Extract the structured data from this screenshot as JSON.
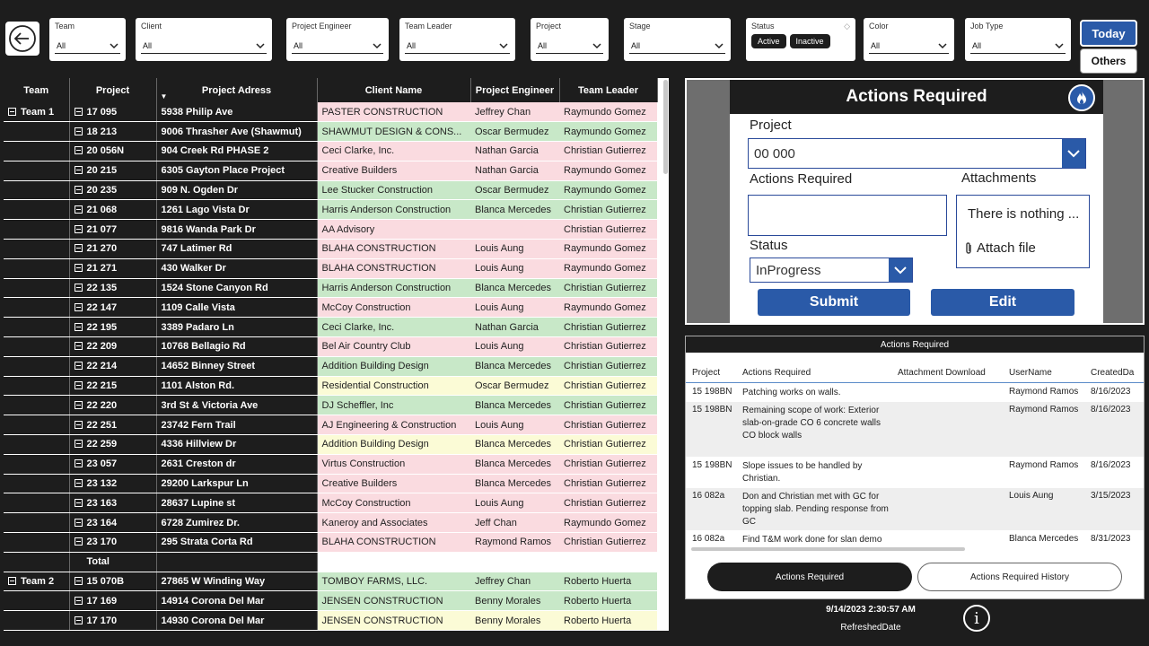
{
  "filters": [
    {
      "label": "Team",
      "value": "All"
    },
    {
      "label": "Client",
      "value": "All"
    },
    {
      "label": "Project Engineer",
      "value": "All"
    },
    {
      "label": "Team Leader",
      "value": "All"
    },
    {
      "label": "Project",
      "value": "All"
    },
    {
      "label": "Stage",
      "value": "All"
    },
    {
      "label": "Color",
      "value": "All"
    },
    {
      "label": "Job Type",
      "value": "All"
    }
  ],
  "status_filter": {
    "label": "Status",
    "options": [
      "Active",
      "Inactive"
    ]
  },
  "buttons": {
    "today": "Today",
    "others": "Others"
  },
  "table": {
    "headers": [
      "Team",
      "Project",
      "Project Adress",
      "Client Name",
      "Project Engineer",
      "Team Leader"
    ],
    "rows": [
      {
        "team": "Team 1",
        "project": "17 095",
        "address": "5938 Philip Ave",
        "client": "PASTER CONSTRUCTION",
        "engineer": "Jeffrey Chan",
        "leader": "Raymundo Gomez",
        "color": "pink"
      },
      {
        "team": "",
        "project": "18 213",
        "address": "9006 Thrasher Ave (Shawmut)",
        "client": "SHAWMUT DESIGN & CONS...",
        "engineer": "Oscar Bermudez",
        "leader": "Raymundo Gomez",
        "color": "green"
      },
      {
        "team": "",
        "project": "20 056N",
        "address": "904 Creek Rd PHASE 2",
        "client": "Ceci Clarke, Inc.",
        "engineer": "Nathan Garcia",
        "leader": "Christian Gutierrez",
        "color": "pink"
      },
      {
        "team": "",
        "project": "20 215",
        "address": "6305 Gayton Place Project",
        "client": "Creative Builders",
        "engineer": "Nathan Garcia",
        "leader": "Raymundo Gomez",
        "color": "pink"
      },
      {
        "team": "",
        "project": "20 235",
        "address": "909 N. Ogden Dr",
        "client": "Lee Stucker Construction",
        "engineer": "Oscar Bermudez",
        "leader": "Raymundo Gomez",
        "color": "green"
      },
      {
        "team": "",
        "project": "21 068",
        "address": "1261 Lago Vista Dr",
        "client": "Harris Anderson Construction",
        "engineer": "Blanca Mercedes",
        "leader": "Christian Gutierrez",
        "color": "green"
      },
      {
        "team": "",
        "project": "21 077",
        "address": "9816 Wanda Park Dr",
        "client": "AA Advisory",
        "engineer": "",
        "leader": "Christian Gutierrez",
        "color": "pink"
      },
      {
        "team": "",
        "project": "21 270",
        "address": "747 Latimer Rd",
        "client": "BLAHA CONSTRUCTION",
        "engineer": "Louis Aung",
        "leader": "Raymundo Gomez",
        "color": "pink"
      },
      {
        "team": "",
        "project": "21 271",
        "address": "430 Walker Dr",
        "client": "BLAHA CONSTRUCTION",
        "engineer": "Louis Aung",
        "leader": "Raymundo Gomez",
        "color": "pink"
      },
      {
        "team": "",
        "project": "22 135",
        "address": "1524 Stone Canyon Rd",
        "client": "Harris Anderson Construction",
        "engineer": "Blanca Mercedes",
        "leader": "Christian Gutierrez",
        "color": "green"
      },
      {
        "team": "",
        "project": "22 147",
        "address": "1109 Calle Vista",
        "client": "McCoy Construction",
        "engineer": "Louis Aung",
        "leader": "Raymundo Gomez",
        "color": "pink"
      },
      {
        "team": "",
        "project": "22 195",
        "address": "3389 Padaro Ln",
        "client": "Ceci Clarke, Inc.",
        "engineer": "Nathan Garcia",
        "leader": "Christian Gutierrez",
        "color": "green"
      },
      {
        "team": "",
        "project": "22 209",
        "address": "10768 Bellagio Rd",
        "client": "Bel Air Country Club",
        "engineer": "Louis Aung",
        "leader": "Christian Gutierrez",
        "color": "pink"
      },
      {
        "team": "",
        "project": "22 214",
        "address": "14652 Binney Street",
        "client": "Addition Building Design",
        "engineer": "Blanca Mercedes",
        "leader": "Christian Gutierrez",
        "color": "green"
      },
      {
        "team": "",
        "project": "22 215",
        "address": "1101 Alston Rd.",
        "client": "Residential Construction",
        "engineer": "Oscar Bermudez",
        "leader": "Christian Gutierrez",
        "color": "yellow"
      },
      {
        "team": "",
        "project": "22 220",
        "address": "3rd St & Victoria Ave",
        "client": "DJ Scheffler, Inc",
        "engineer": "Blanca Mercedes",
        "leader": "Christian Gutierrez",
        "color": "green"
      },
      {
        "team": "",
        "project": "22 251",
        "address": "23742 Fern Trail",
        "client": "AJ Engineering & Construction",
        "engineer": "Louis Aung",
        "leader": "Christian Gutierrez",
        "color": "pink"
      },
      {
        "team": "",
        "project": "22 259",
        "address": "4336 Hillview Dr",
        "client": "Addition Building Design",
        "engineer": "Blanca Mercedes",
        "leader": "Christian Gutierrez",
        "color": "yellow"
      },
      {
        "team": "",
        "project": "23 057",
        "address": "2631 Creston dr",
        "client": "Virtus Construction",
        "engineer": "Blanca Mercedes",
        "leader": "Christian Gutierrez",
        "color": "pink"
      },
      {
        "team": "",
        "project": "23 132",
        "address": "29200 Larkspur Ln",
        "client": "Creative Builders",
        "engineer": "Blanca Mercedes",
        "leader": "Christian Gutierrez",
        "color": "pink"
      },
      {
        "team": "",
        "project": "23 163",
        "address": "28637 Lupine st",
        "client": "McCoy Construction",
        "engineer": "Louis Aung",
        "leader": "Christian Gutierrez",
        "color": "pink"
      },
      {
        "team": "",
        "project": "23 164",
        "address": "6728 Zumirez Dr.",
        "client": "Kaneroy and Associates",
        "engineer": "Jeff Chan",
        "leader": "Raymundo Gomez",
        "color": "pink"
      },
      {
        "team": "",
        "project": "23 170",
        "address": "295 Strata Corta Rd",
        "client": "BLAHA CONSTRUCTION",
        "engineer": "Raymond Ramos",
        "leader": "Christian Gutierrez",
        "color": "pink"
      },
      {
        "team": "",
        "project": "Total",
        "address": "",
        "client": "",
        "engineer": "",
        "leader": "",
        "color": "total",
        "is_total": true
      },
      {
        "team": "Team 2",
        "project": "15 070B",
        "address": "27865 W Winding Way",
        "client": "TOMBOY FARMS, LLC.",
        "engineer": "Jeffrey Chan",
        "leader": "Roberto Huerta",
        "color": "green"
      },
      {
        "team": "",
        "project": "17 169",
        "address": "14914 Corona Del Mar",
        "client": "JENSEN CONSTRUCTION",
        "engineer": "Benny Morales",
        "leader": "Roberto Huerta",
        "color": "green"
      },
      {
        "team": "",
        "project": "17 170",
        "address": "14930 Corona Del Mar",
        "client": "JENSEN CONSTRUCTION",
        "engineer": "Benny Morales",
        "leader": "Roberto Huerta",
        "color": "yellow"
      }
    ]
  },
  "form": {
    "title": "Actions Required",
    "project_label": "Project",
    "project_value": "00 000",
    "actions_label": "Actions Required",
    "attachments_label": "Attachments",
    "attachments_empty": "There is nothing ...",
    "attach_file": "Attach file",
    "status_label": "Status",
    "status_value": "InProgress",
    "submit": "Submit",
    "edit": "Edit"
  },
  "actions_list": {
    "title": "Actions Required",
    "columns": [
      "Project",
      "Actions Required",
      "Attachment Download",
      "UserName",
      "CreatedDa"
    ],
    "rows": [
      {
        "project": "15 198BN",
        "action": "Patching works on walls.",
        "user": "Raymond Ramos",
        "date": "8/16/2023",
        "lines": 1
      },
      {
        "project": "15 198BN",
        "action": "Remaining scope of work: Exterior slab-on-grade CO 6 concrete walls CO block walls",
        "user": "Raymond Ramos",
        "date": "8/16/2023",
        "lines": 4
      },
      {
        "project": "15 198BN",
        "action": "Slope issues to be handled by Christian.",
        "user": "Raymond Ramos",
        "date": "8/16/2023",
        "lines": 2
      },
      {
        "project": "16 082a",
        "action": "Don and Christian met with GC for topping slab. Pending response from GC",
        "user": "Louis Aung",
        "date": "3/15/2023",
        "lines": 3
      },
      {
        "project": "16 082a",
        "action": "Find T&M work done for slan demo and quantify dollars",
        "user": "Blanca Mercedes",
        "date": "8/31/2023",
        "lines": 2
      }
    ],
    "tabs": [
      "Actions Required",
      "Actions Required History"
    ]
  },
  "footer": {
    "refreshed_value": "9/14/2023 2:30:57 AM",
    "refreshed_label": "RefreshedDate"
  },
  "icons": {
    "back": "back-arrow-icon",
    "fire": "fire-icon",
    "info": "info-icon",
    "clip": "paperclip-icon"
  },
  "colors": {
    "pink": "#fadbe0",
    "green": "#c8e8c8",
    "yellow": "#fbfbd6",
    "accent": "#2a5aa8",
    "dark": "#1d1d1d"
  }
}
